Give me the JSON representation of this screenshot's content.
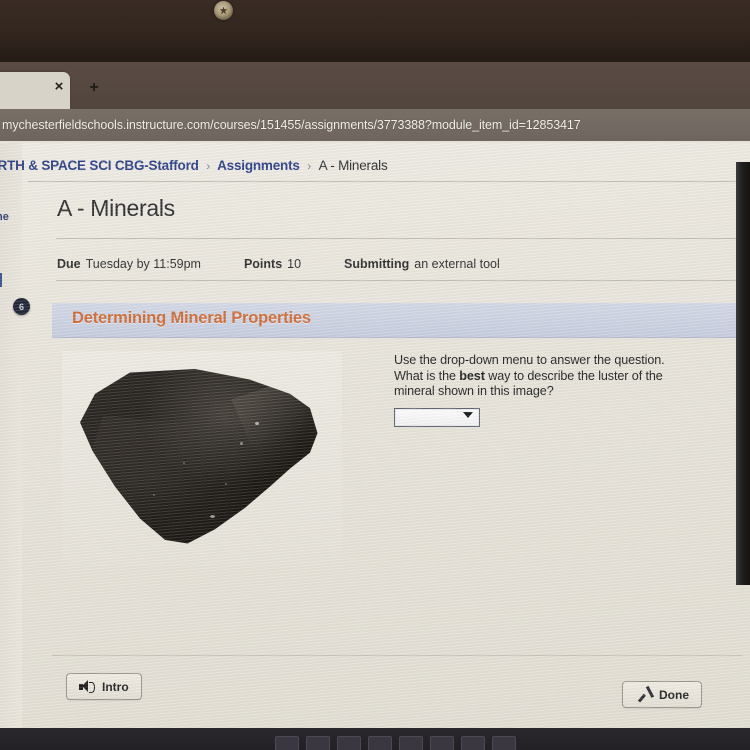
{
  "browser": {
    "tab_close_icon": "close-icon",
    "tab_close_glyph": "×",
    "new_tab_icon": "plus-icon",
    "new_tab_glyph": "+",
    "url": "mychesterfieldschools.instructure.com/courses/151455/assignments/3773388?module_item_id=12853417"
  },
  "sidebar": {
    "partial_label": "ne",
    "badge": "6"
  },
  "breadcrumb": {
    "course": "ARTH & SPACE SCI CBG-Stafford",
    "section": "Assignments",
    "current": "A - Minerals",
    "separator": "›"
  },
  "assignment": {
    "title": "A - Minerals",
    "due_label": "Due",
    "due_value": "Tuesday by 11:59pm",
    "points_label": "Points",
    "points_value": "10",
    "submitting_label": "Submitting",
    "submitting_value": "an external tool"
  },
  "tool": {
    "heading": "Determining Mineral Properties",
    "question_line1": "Use the drop-down menu to answer the question.",
    "question_line2_pre": "What is the ",
    "question_line2_bold": "best",
    "question_line2_post": " way to describe the luster of the",
    "question_line3": "mineral shown in this image?",
    "dropdown_value": "",
    "dropdown_icon": "chevron-down-icon",
    "image_alt": "dark angular mineral specimen",
    "intro_button": "Intro",
    "intro_icon": "speaker-icon",
    "done_button": "Done",
    "done_icon": "check-icon"
  },
  "colors": {
    "accent_orange": "#cf6b33",
    "link_blue": "#2a3f86",
    "panel_header": "#c6cdde"
  }
}
